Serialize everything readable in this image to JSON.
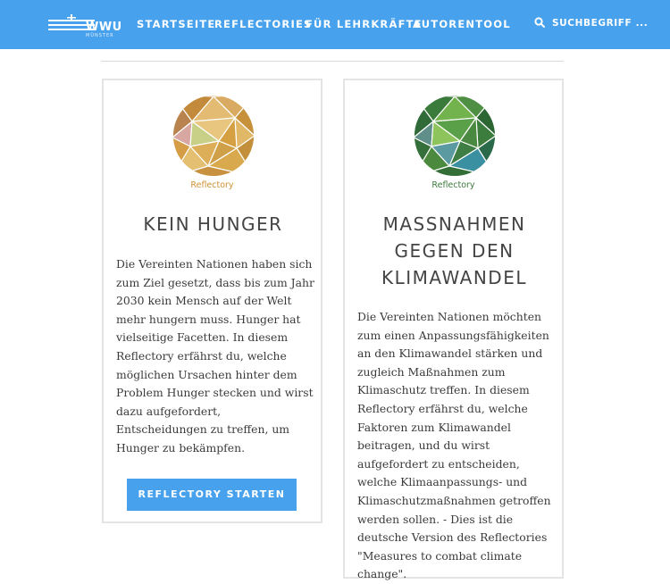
{
  "header": {
    "logo_text": "WWU",
    "logo_sub": "MÜNSTER",
    "nav": [
      "STARTSEITE",
      "REFLECTORIES",
      "FÜR LEHRKRÄFTE",
      "AUTORENTOOL"
    ],
    "search_placeholder": "SUCHBEGRIFF ..."
  },
  "cards": [
    {
      "badge_label": "Reflectory",
      "badge_color": "#d8a84e",
      "title_lines": [
        "KEIN HUNGER"
      ],
      "description": "Die Vereinten Nationen haben sich zum Ziel gesetzt, dass bis zum Jahr 2030 kein Mensch auf der Welt mehr hungern muss. Hunger hat vielseitige Facetten. In diesem Reflectory erfährst du, welche möglichen Ursachen hinter dem Problem Hunger stecken und wirst dazu aufgefordert, Entscheidungen zu treffen, um Hunger zu bekämpfen.",
      "button": "REFLECTORY STARTEN"
    },
    {
      "badge_label": "Reflectory",
      "badge_color": "#3f7e3f",
      "title_lines": [
        "MASSNAHMEN",
        "GEGEN DEN",
        "KLIMAWANDEL"
      ],
      "description": "Die Vereinten Nationen möchten zum einen Anpassungsfähigkeiten an den Klimawandel stärken und zugleich Maßnahmen zum Klimaschutz treffen. In diesem Reflectory erfährst du, welche Faktoren zum Klimawandel beitragen, und du wirst aufgefordert zu entscheiden, welche Klimaanpassungs- und Klimaschutzmaßnahmen getroffen werden sollen. - Dies ist die deutsche Version des Reflectories \"Measures to combat climate change\"."
    }
  ]
}
